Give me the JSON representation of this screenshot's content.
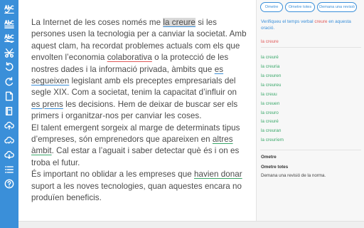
{
  "toolbar": {
    "buttons": [
      {
        "name": "spellcheck-ortho-icon",
        "icon": "abc-check"
      },
      {
        "name": "spellcheck-grammar-icon",
        "icon": "abc-check-2"
      },
      {
        "name": "spellcheck-style-icon",
        "icon": "abc-strike"
      },
      {
        "name": "cut-icon",
        "icon": "scissors"
      },
      {
        "name": "undo-icon",
        "icon": "undo"
      },
      {
        "name": "redo-icon",
        "icon": "redo"
      },
      {
        "name": "new-document-icon",
        "icon": "document"
      },
      {
        "name": "book-icon",
        "icon": "book"
      },
      {
        "name": "cloud-upload-icon",
        "icon": "cloud-up"
      },
      {
        "name": "cloud-save-icon",
        "icon": "cloud-save"
      },
      {
        "name": "cloud-download-icon",
        "icon": "cloud-down"
      },
      {
        "name": "list-icon",
        "icon": "list"
      },
      {
        "name": "help-icon",
        "icon": "question"
      }
    ]
  },
  "editor": {
    "p1": {
      "t1": "La Internet de les coses només me ",
      "hl": "la creure",
      "t2": " si les persones usen la tecnologia per a canviar la societat. Amb aquest clam, ha recordat problemes actuals com els que envolten l’economia ",
      "e1": "colaborativa",
      "t3": " o la protecció de les nostres dades i la informació privada, àmbits que ",
      "e2": "es segueixen",
      "t4": " legislant amb els preceptes empresarials del segle XIX. Com a societat, tenim la capacitat d’influir on ",
      "e3": "es prens",
      "t5": " les decisions. Hem de deixar de buscar ser els primers i organitzar-nos per canviar les coses."
    },
    "p2": {
      "t1": "El talent emergent sorgeix al marge de determinats tipus d’empreses, són emprenedors que apareixen en ",
      "e1": "altres àmbit",
      "t2": ". Cal estar a l’aguait i saber detectar què és i on es troba el futur."
    },
    "p3": {
      "t1": "És important no oblidar a les empreses que ",
      "e1": "havien donar",
      "t2": " suport a les noves tecnologies, quan aquestes encara no produïen beneficis."
    }
  },
  "panel": {
    "buttons": {
      "omit": "Ometre",
      "omit_all": "Ometre totes",
      "report": "Demana una revisió"
    },
    "message": {
      "pre": "Verifiqueu el temps verbal ",
      "word": "creure",
      "post": " en aquesta oració."
    },
    "original": "la creure",
    "suggestions": [
      "la creuré",
      "la creuria",
      "la creuren",
      "la creureu",
      "la creuu",
      "la creuen",
      "la creuro",
      "la creuré",
      "la creuran",
      "la creuríem"
    ],
    "rule": {
      "omit": "Ometre",
      "omit_all": "Ometre totes",
      "desc": "Demana una revisió de la norma."
    }
  },
  "colors": {
    "toolbar": "#3a8fd9",
    "accent": "#3a8fd9",
    "error": "#e05a5a",
    "suggestion": "#3aa86a"
  }
}
